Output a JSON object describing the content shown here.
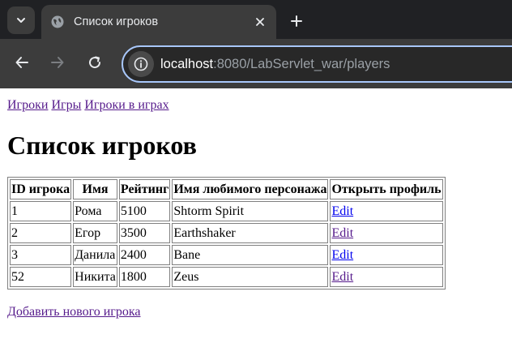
{
  "browser": {
    "tab_title": "Список игроков",
    "url_host": "localhost",
    "url_path": ":8080/LabServlet_war/players"
  },
  "nav": {
    "links": [
      "Игроки",
      "Игры",
      "Игроки в играх"
    ]
  },
  "page_title": "Список игроков",
  "table": {
    "headers": [
      "ID игрока",
      "Имя",
      "Рейтинг",
      "Имя любимого персонажа",
      "Открыть профиль"
    ],
    "rows": [
      {
        "id": "1",
        "name": "Рома",
        "rating": "5100",
        "character": "Shtorm Spirit",
        "action": "Edit"
      },
      {
        "id": "2",
        "name": "Егор",
        "rating": "3500",
        "character": "Earthshaker",
        "action": "Edit"
      },
      {
        "id": "3",
        "name": "Данила",
        "rating": "2400",
        "character": "Bane",
        "action": "Edit"
      },
      {
        "id": "52",
        "name": "Никита",
        "rating": "1800",
        "character": "Zeus",
        "action": "Edit"
      }
    ]
  },
  "add_link": "Добавить нового игрока",
  "colors": {
    "visited_link": "#551a8b",
    "unvisited_link": "#0000ee",
    "omnibox_focus": "#a8c7fa"
  }
}
